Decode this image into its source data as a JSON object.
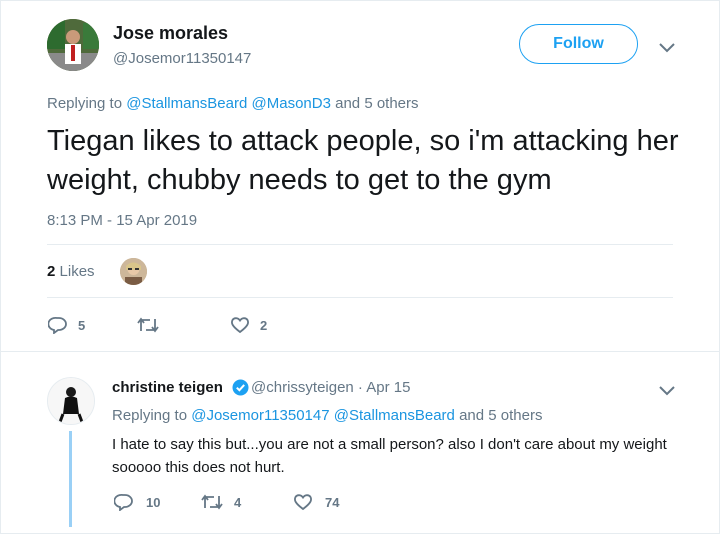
{
  "main_tweet": {
    "display_name": "Jose morales",
    "handle": "@Josemor11350147",
    "follow_label": "Follow",
    "replying_prefix": "Replying to",
    "replying_to_1": "@StallmansBeard",
    "replying_to_2": "@MasonD3",
    "replying_suffix": "and 5 others",
    "text": "Tiegan likes to attack people, so i'm attacking her weight, chubby needs to get to the gym",
    "timestamp": "8:13 PM - 15 Apr 2019",
    "likes_count": "2",
    "likes_label": "Likes",
    "actions": {
      "reply_count": "5",
      "retweet_count": "",
      "like_count": "2"
    }
  },
  "reply_tweet": {
    "display_name": "christine teigen",
    "handle_and_date": "@chrissyteigen · Apr 15",
    "replying_prefix": "Replying to",
    "replying_to_1": "@Josemor11350147",
    "replying_to_2": "@StallmansBeard",
    "replying_suffix": "and 5 others",
    "text": "I hate to say this but...you are not a small person? also I don't care about my weight sooooo this does not hurt.",
    "actions": {
      "reply_count": "10",
      "retweet_count": "4",
      "like_count": "74"
    }
  },
  "icons": [
    "chevron-down-icon",
    "reply-icon",
    "retweet-icon",
    "heart-icon",
    "verified-badge-icon"
  ],
  "colors": {
    "link": "#1b95e0",
    "accent": "#1da1f2",
    "muted": "#657786",
    "thread": "#9ad0f6"
  }
}
